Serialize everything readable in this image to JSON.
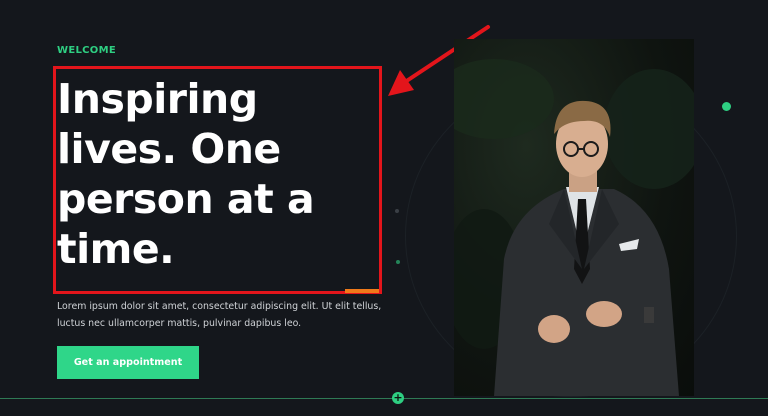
{
  "hero": {
    "eyebrow": "WELCOME",
    "headline": "Inspiring lives. One person at a time.",
    "description": "Lorem ipsum dolor sit amet, consectetur adipiscing elit. Ut elit tellus, luctus nec ullamcorper mattis, pulvinar dapibus leo.",
    "cta_label": "Get an appointment"
  },
  "colors": {
    "background": "#14171c",
    "accent": "#2fd689",
    "annotation": "#e3151b"
  },
  "icons": {
    "bottom_marker": "plus-icon",
    "annotation_pointer": "arrow-icon"
  },
  "bottom_marker": {
    "symbol": "+"
  }
}
